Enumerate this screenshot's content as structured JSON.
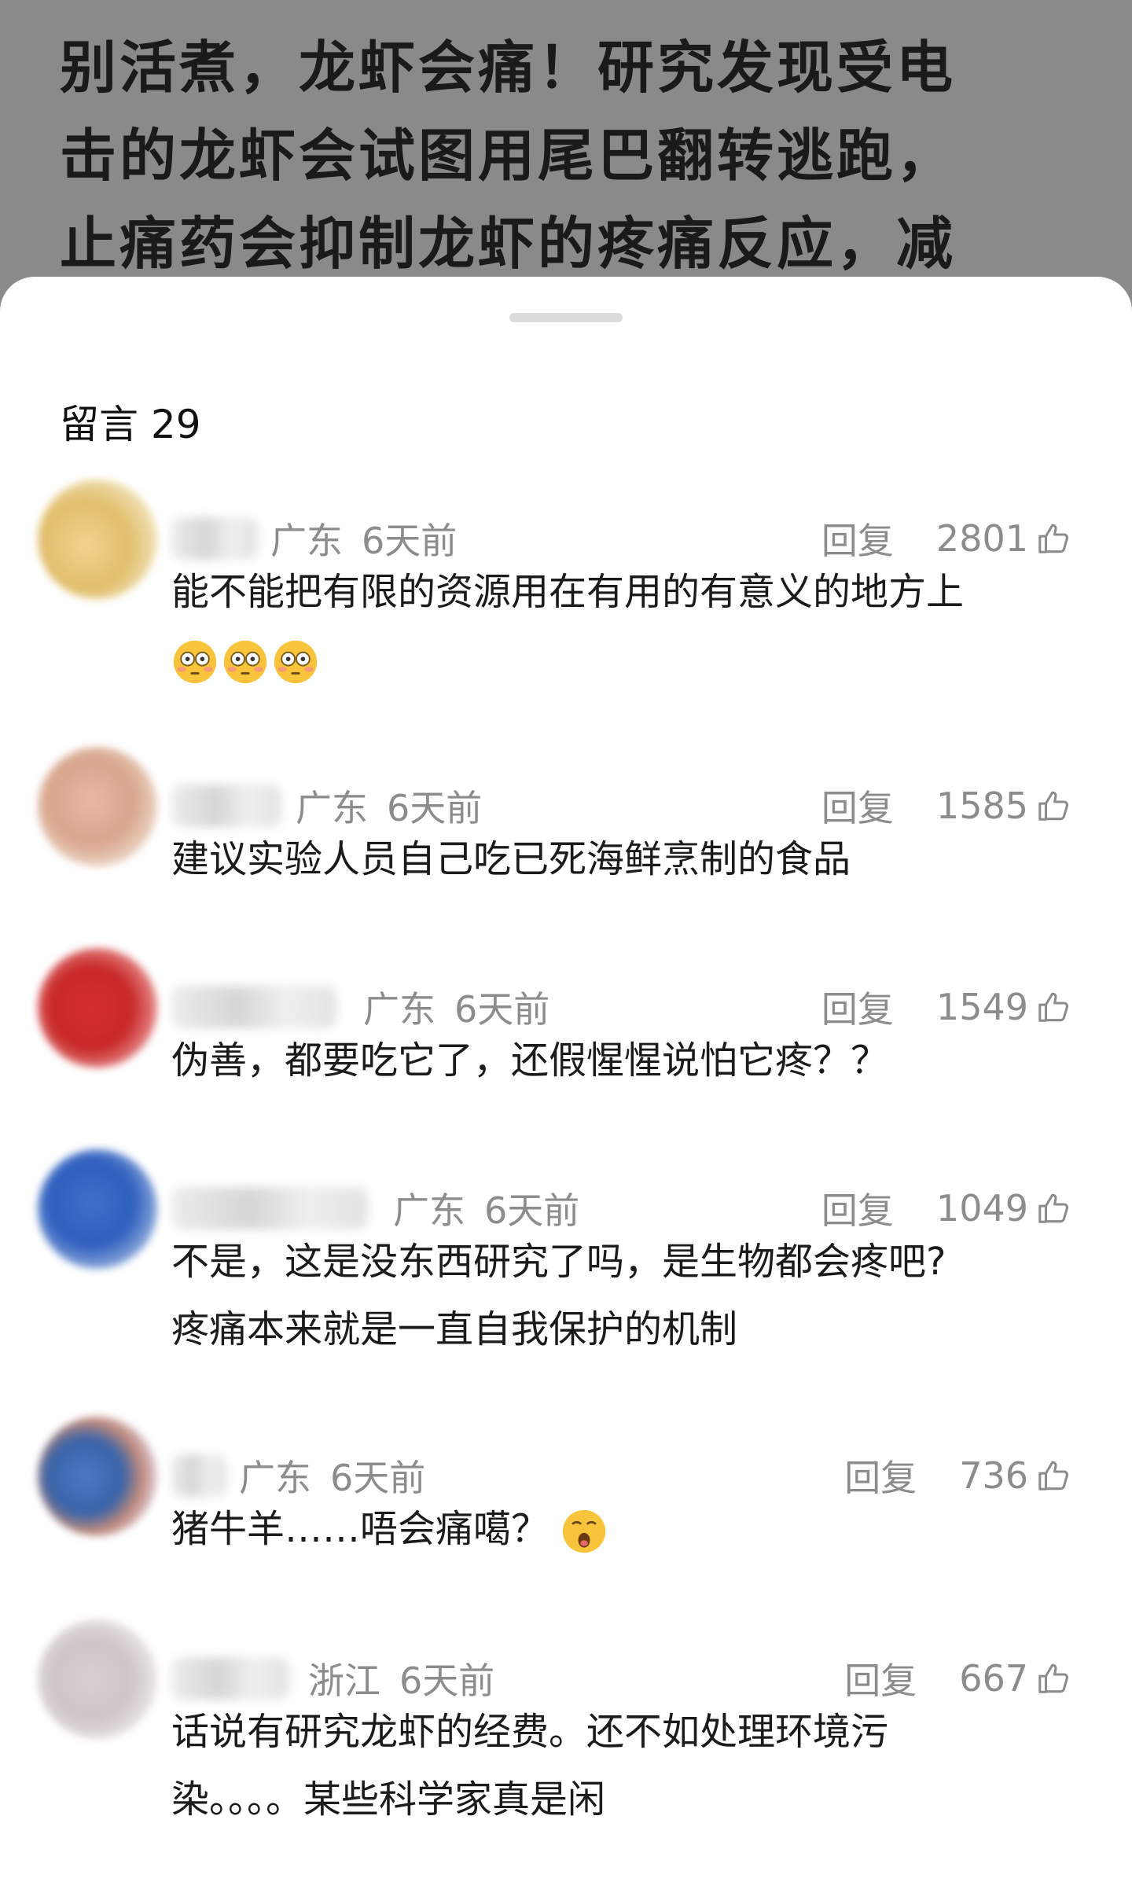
{
  "post": {
    "headline_lines": [
      "别活煮，龙虾会痛！研究发现受电",
      "击的龙虾会试图用尾巴翻转逃跑，",
      "止痛药会抑制龙虾的疼痛反应，减"
    ]
  },
  "comments_header": "留言 29",
  "reply_label": "回复",
  "comments": [
    {
      "location": "广东",
      "time": "6天前",
      "likes": "2801",
      "text_lines": [
        "能不能把有限的资源用在有用的有意义的地方上"
      ],
      "emoji": [
        "flushed-face",
        "flushed-face",
        "flushed-face"
      ]
    },
    {
      "location": "广东",
      "time": "6天前",
      "likes": "1585",
      "text_lines": [
        "建议实验人员自己吃已死海鲜烹制的食品"
      ]
    },
    {
      "location": "广东",
      "time": "6天前",
      "likes": "1549",
      "text_lines": [
        "伪善，都要吃它了，还假惺惺说怕它疼？？"
      ]
    },
    {
      "location": "广东",
      "time": "6天前",
      "likes": "1049",
      "text_lines": [
        "不是，这是没东西研究了吗，是生物都会疼吧?",
        "疼痛本来就是一直自我保护的机制"
      ]
    },
    {
      "location": "广东",
      "time": "6天前",
      "likes": "736",
      "text_lines": [
        "猪牛羊……唔会痛噶？"
      ],
      "emoji": [
        "astonished-face"
      ]
    },
    {
      "location": "浙江",
      "time": "6天前",
      "likes": "667",
      "text_lines": [
        "话说有研究龙虾的经费。还不如处理环境污",
        "染。。。。某些科学家真是闲"
      ]
    }
  ],
  "colors": {
    "overlay": "#8a8a8a",
    "sheet": "#ffffff",
    "meta_text": "#8c8c8c",
    "body_text": "#1b1b1b"
  }
}
